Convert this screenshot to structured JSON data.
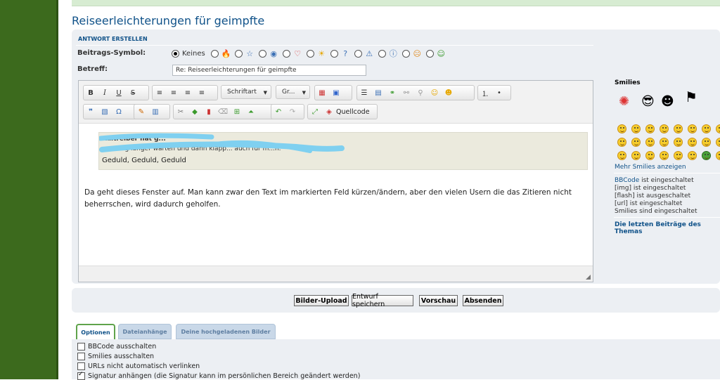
{
  "page": {
    "title": "Reiseerleichterungen für geimpfte"
  },
  "reply": {
    "heading": "ANTWORT ERSTELLEN",
    "icon_label": "Beitrags-Symbol:",
    "icon_none": "Keines",
    "icons": [
      "fire-icon",
      "star-icon",
      "shocked-icon",
      "heart-icon",
      "sun-icon",
      "question-icon",
      "warning-icon",
      "info-icon",
      "surprised-icon",
      "happy-icon"
    ],
    "subject_label": "Betreff:",
    "subject_value": "Re: Reiseerleichterungen für geimpfte"
  },
  "toolbar": {
    "font_select": "Schriftart",
    "size_select": "Gr...",
    "source_button": "Quellcode"
  },
  "editor": {
    "quote_line1": "Kaltreiber hat g...",
    "quote_line2": "... wenig länger warten und dann klapp... auch für m...h.",
    "quote_line3": "Geduld, Geduld, Geduld",
    "body": "Da geht dieses Fenster auf. Man kann zwar den Text im markierten Feld kürzen/ändern, aber  den vielen Usern die das Zitieren nicht beherrschen, wird dadurch geholfen."
  },
  "sidebar": {
    "smilies_title": "Smilies",
    "more_smilies": "Mehr Smilies anzeigen",
    "bbcode_link": "BBCode",
    "bbcode_status": " ist eingeschaltet",
    "img_status": "[img] ist eingeschaltet",
    "flash_status": "[flash] ist ausgeschaltet",
    "url_status": "[url] ist eingeschaltet",
    "smilies_status": "Smilies sind eingeschaltet",
    "last_posts": "Die letzten Beiträge des Themas"
  },
  "buttons": {
    "upload": "Bilder-Upload",
    "draft": "Entwurf speichern",
    "preview": "Vorschau",
    "submit": "Absenden"
  },
  "tabs": [
    "Optionen",
    "Dateianhänge",
    "Deine hochgeladenen Bilder"
  ],
  "options": [
    {
      "label": "BBCode ausschalten",
      "checked": false
    },
    {
      "label": "Smilies ausschalten",
      "checked": false
    },
    {
      "label": "URLs nicht automatisch verlinken",
      "checked": false
    },
    {
      "label": "Signatur anhängen (die Signatur kann im persönlichen Bereich geändert werden)",
      "checked": true
    }
  ]
}
